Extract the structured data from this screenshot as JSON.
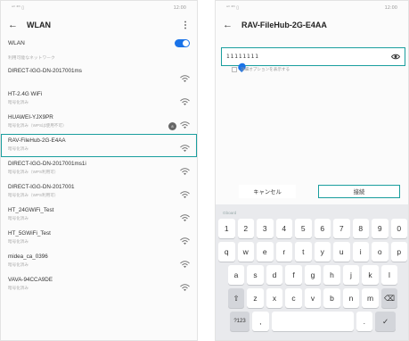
{
  "left": {
    "status_left": "ᵃˡˡ ⁴ᴳ ▯",
    "status_right": "12:00",
    "title": "WLAN",
    "wlan_label": "WLAN",
    "section_label": "利用可能なネットワーク",
    "networks": [
      {
        "name": "DIRECT-IGG-DN-2017001ms",
        "status": "",
        "selected": false
      },
      {
        "name": "HT-2.4G WiFi",
        "status": "暗号化済み",
        "selected": false
      },
      {
        "name": "HUAWEI-YJX9PR",
        "status": "暗号化済み（WPSは使用不可）",
        "selected": false,
        "badge": true
      },
      {
        "name": "RAV-FileHub-2G-E4AA",
        "status": "暗号化済み",
        "selected": true
      },
      {
        "name": "DIRECT-IGG-DN-2017001ms1i",
        "status": "暗号化済み（WPS利用可）",
        "selected": false
      },
      {
        "name": "DIRECT-IGG-DN-2017001",
        "status": "暗号化済み（WPS利用可）",
        "selected": false
      },
      {
        "name": "HT_24GWiFi_Test",
        "status": "暗号化済み",
        "selected": false
      },
      {
        "name": "HT_5GWiFi_Test",
        "status": "暗号化済み",
        "selected": false
      },
      {
        "name": "midea_ca_0396",
        "status": "暗号化済み",
        "selected": false
      },
      {
        "name": "VAVA-94CCA9DE",
        "status": "暗号化済み",
        "selected": false
      }
    ],
    "badge_text": "8"
  },
  "right": {
    "status_left": "ᵃˡˡ ⁴ᴳ ▯",
    "status_right": "12:00",
    "title": "RAV-FileHub-2G-E4AA",
    "password_value": "11111111",
    "options_label": "詳細オプションを表示する",
    "cancel_label": "キャンセル",
    "connect_label": "接続",
    "keyboard_hint": "Gboard",
    "keys_row1": [
      "1",
      "2",
      "3",
      "4",
      "5",
      "6",
      "7",
      "8",
      "9",
      "0"
    ],
    "keys_row2": [
      "q",
      "w",
      "e",
      "r",
      "t",
      "y",
      "u",
      "i",
      "o",
      "p"
    ],
    "keys_row3": [
      "a",
      "s",
      "d",
      "f",
      "g",
      "h",
      "j",
      "k",
      "l"
    ],
    "keys_row4_letters": [
      "z",
      "x",
      "c",
      "v",
      "b",
      "n",
      "m"
    ],
    "shift_glyph": "⇧",
    "backspace_glyph": "⌫",
    "symbols_label": "?123",
    "comma_label": ",",
    "period_label": ".",
    "enter_glyph": "✓"
  },
  "colors": {
    "accent_highlight": "#1a9e9e",
    "toggle": "#1a73e8"
  }
}
